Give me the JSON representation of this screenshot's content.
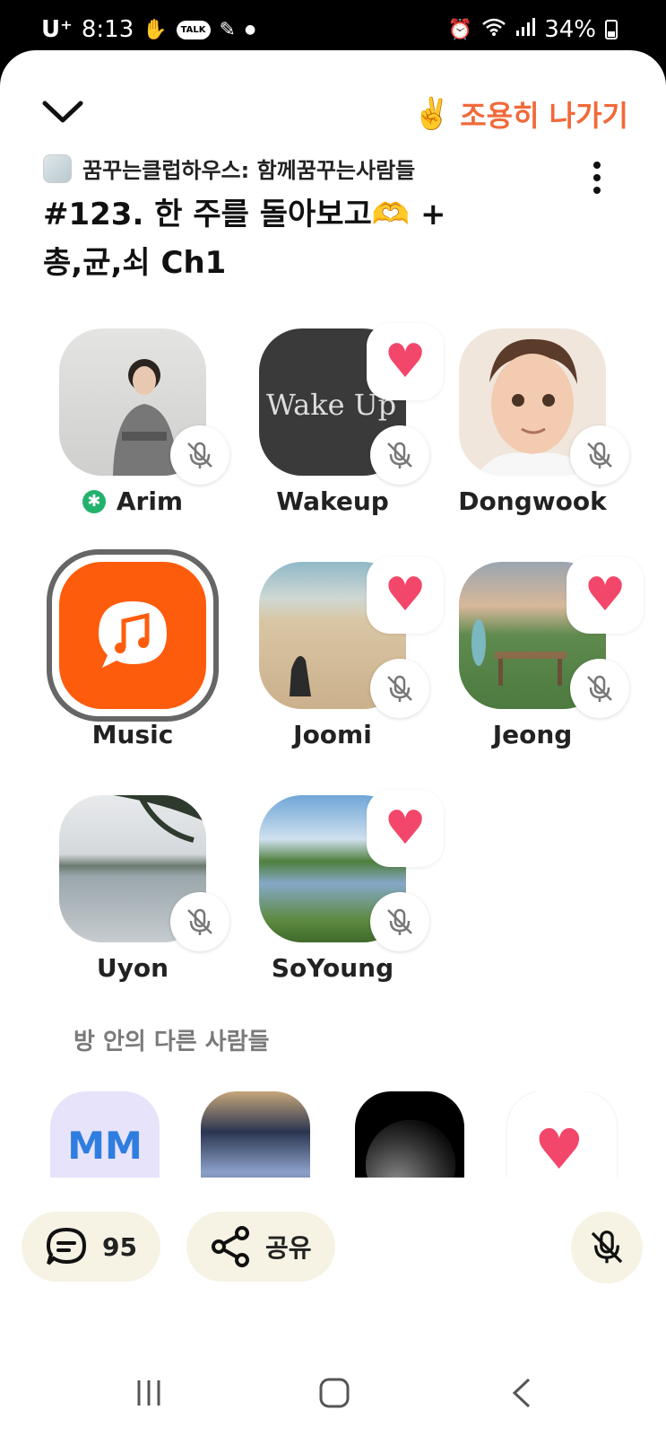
{
  "status_bar": {
    "carrier": "U⁺",
    "time": "8:13",
    "talk_label": "TALK",
    "battery": "34%"
  },
  "header": {
    "collapse_icon": "chevron-down-icon",
    "leave_label": "조용히 나가기",
    "leave_emoji": "✌️",
    "club_name": "꿈꾸는클럽하우스: 함께꿈꾸는사람들",
    "room_title_line1": "#123. 한 주를 돌아보고",
    "room_title_emoji": "🫶",
    "room_title_line1_suffix": " +",
    "room_title_line2": "총,균,쇠 Ch1"
  },
  "speakers": [
    {
      "name": "Arim",
      "moderator": true,
      "muted": true,
      "heart": false
    },
    {
      "name": "Wakeup",
      "moderator": false,
      "muted": true,
      "heart": true,
      "avatar_text": "Wake Up"
    },
    {
      "name": "Dongwook",
      "moderator": false,
      "muted": true,
      "heart": false
    },
    {
      "name": "Music",
      "moderator": false,
      "muted": false,
      "heart": false,
      "speaking": true
    },
    {
      "name": "Joomi",
      "moderator": false,
      "muted": true,
      "heart": true
    },
    {
      "name": "Jeong",
      "moderator": false,
      "muted": true,
      "heart": true
    },
    {
      "name": "Uyon",
      "moderator": false,
      "muted": true,
      "heart": false
    },
    {
      "name": "SoYoung",
      "moderator": false,
      "muted": true,
      "heart": true
    }
  ],
  "others": {
    "title": "방 안의 다른 사람들",
    "listeners": [
      {
        "initials": "MM"
      },
      {
        "initials": ""
      },
      {
        "initials": ""
      },
      {
        "initials": ""
      }
    ]
  },
  "bottom_bar": {
    "chat_count": "95",
    "share_label": "공유"
  },
  "colors": {
    "accent": "#f06a3a",
    "pill_bg": "#f6f3e4",
    "heart": "#f2476a",
    "moderator": "#23b26d",
    "music_orange": "#fe5c0d"
  }
}
